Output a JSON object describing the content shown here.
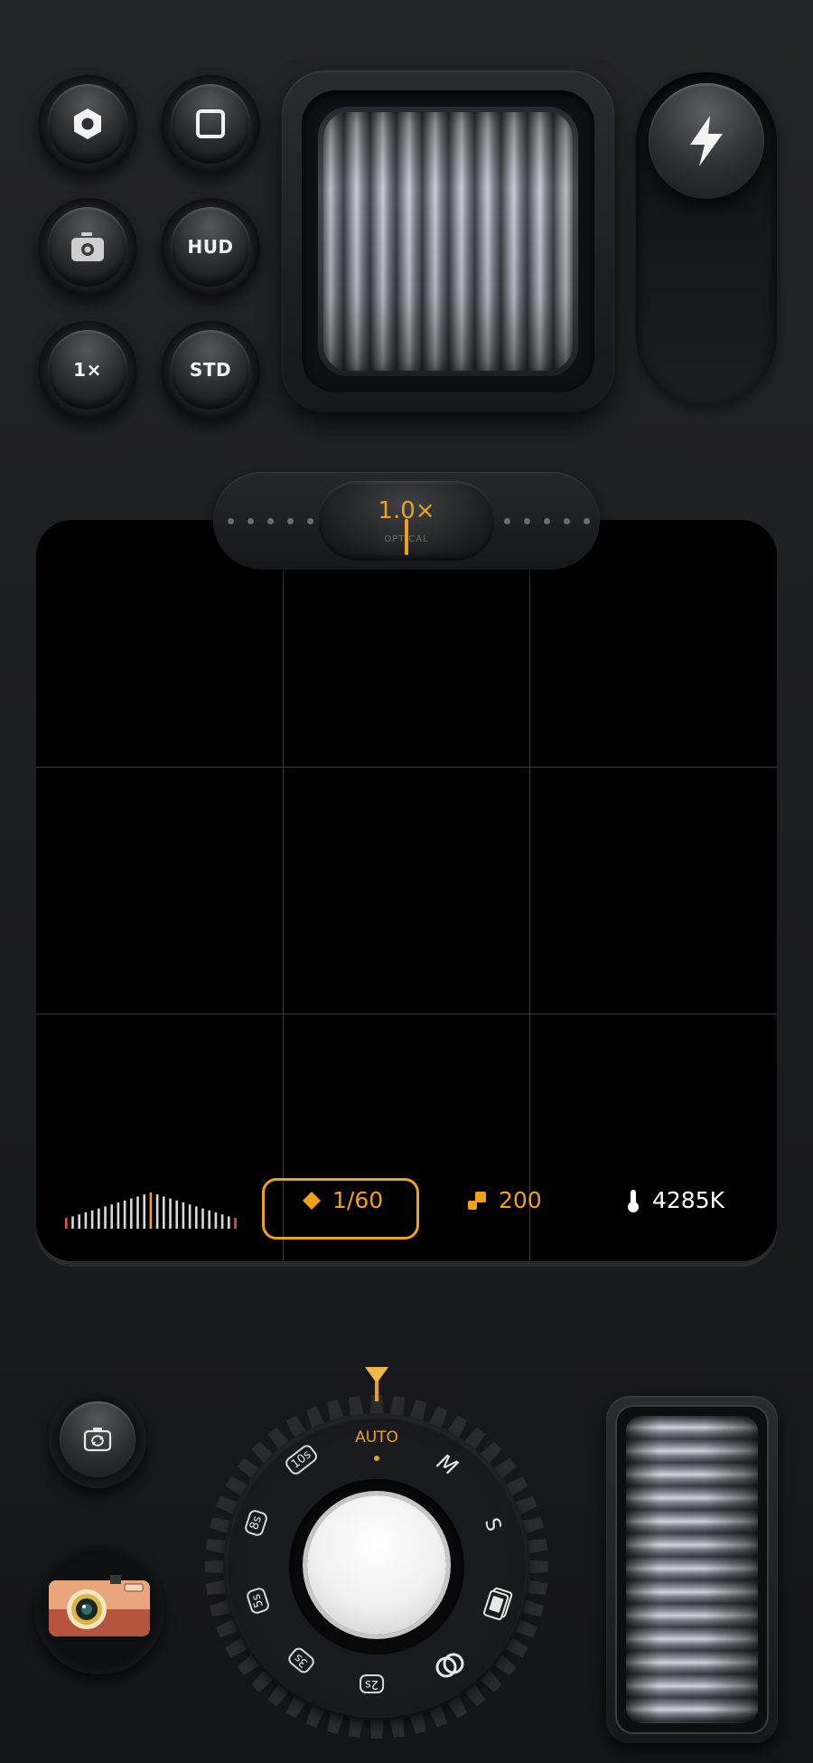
{
  "top_controls": {
    "buttons": [
      {
        "id": "settings",
        "label": "",
        "icon": "hexagon-settings-icon"
      },
      {
        "id": "aspect",
        "label": "",
        "icon": "square-frame-icon"
      },
      {
        "id": "camera",
        "label": "",
        "icon": "camera-icon"
      },
      {
        "id": "hud",
        "label": "HUD",
        "icon": ""
      },
      {
        "id": "zoom_level",
        "label": "1×",
        "icon": ""
      },
      {
        "id": "profile",
        "label": "STD",
        "icon": ""
      }
    ],
    "flash_icon": "lightning-bolt-icon"
  },
  "zoom": {
    "value": "1.0×",
    "caption": "OPTICAL"
  },
  "readouts": {
    "shutter": "1/60",
    "iso": "200",
    "white_balance": "4285K"
  },
  "mode_dial": {
    "selected": "AUTO",
    "modes": [
      "AUTO",
      "M",
      "S"
    ],
    "timers": [
      "10s",
      "8s",
      "5s",
      "3s",
      "2s"
    ],
    "accent_color": "#f0a11a"
  },
  "bottom": {
    "flip_camera_icon": "flip-camera-icon",
    "gallery_icon": "retro-camera-thumbnail"
  }
}
